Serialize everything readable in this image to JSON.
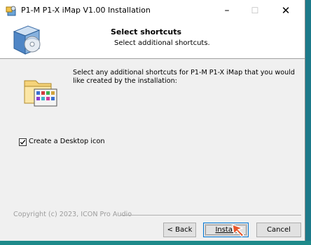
{
  "window": {
    "title": "P1-M P1-X iMap V1.00 Installation",
    "controls": {
      "minimize": "–",
      "maximize": "☐",
      "close": "✕"
    }
  },
  "header": {
    "title": "Select shortcuts",
    "subtitle": "Select additional shortcuts."
  },
  "content": {
    "description": "Select any additional shortcuts for P1-M P1-X iMap that you would like created by the installation:",
    "checkbox": {
      "label": "Create a Desktop icon",
      "checked": true
    }
  },
  "footer": {
    "copyright": "Copyright (c) 2023, ICON Pro Audio",
    "back_label": "< Back",
    "install_label": "Install",
    "cancel_label": "Cancel"
  },
  "colors": {
    "accent": "#0078d7",
    "cursor": "#e8562a",
    "taskbar": "#1d7a8a"
  }
}
